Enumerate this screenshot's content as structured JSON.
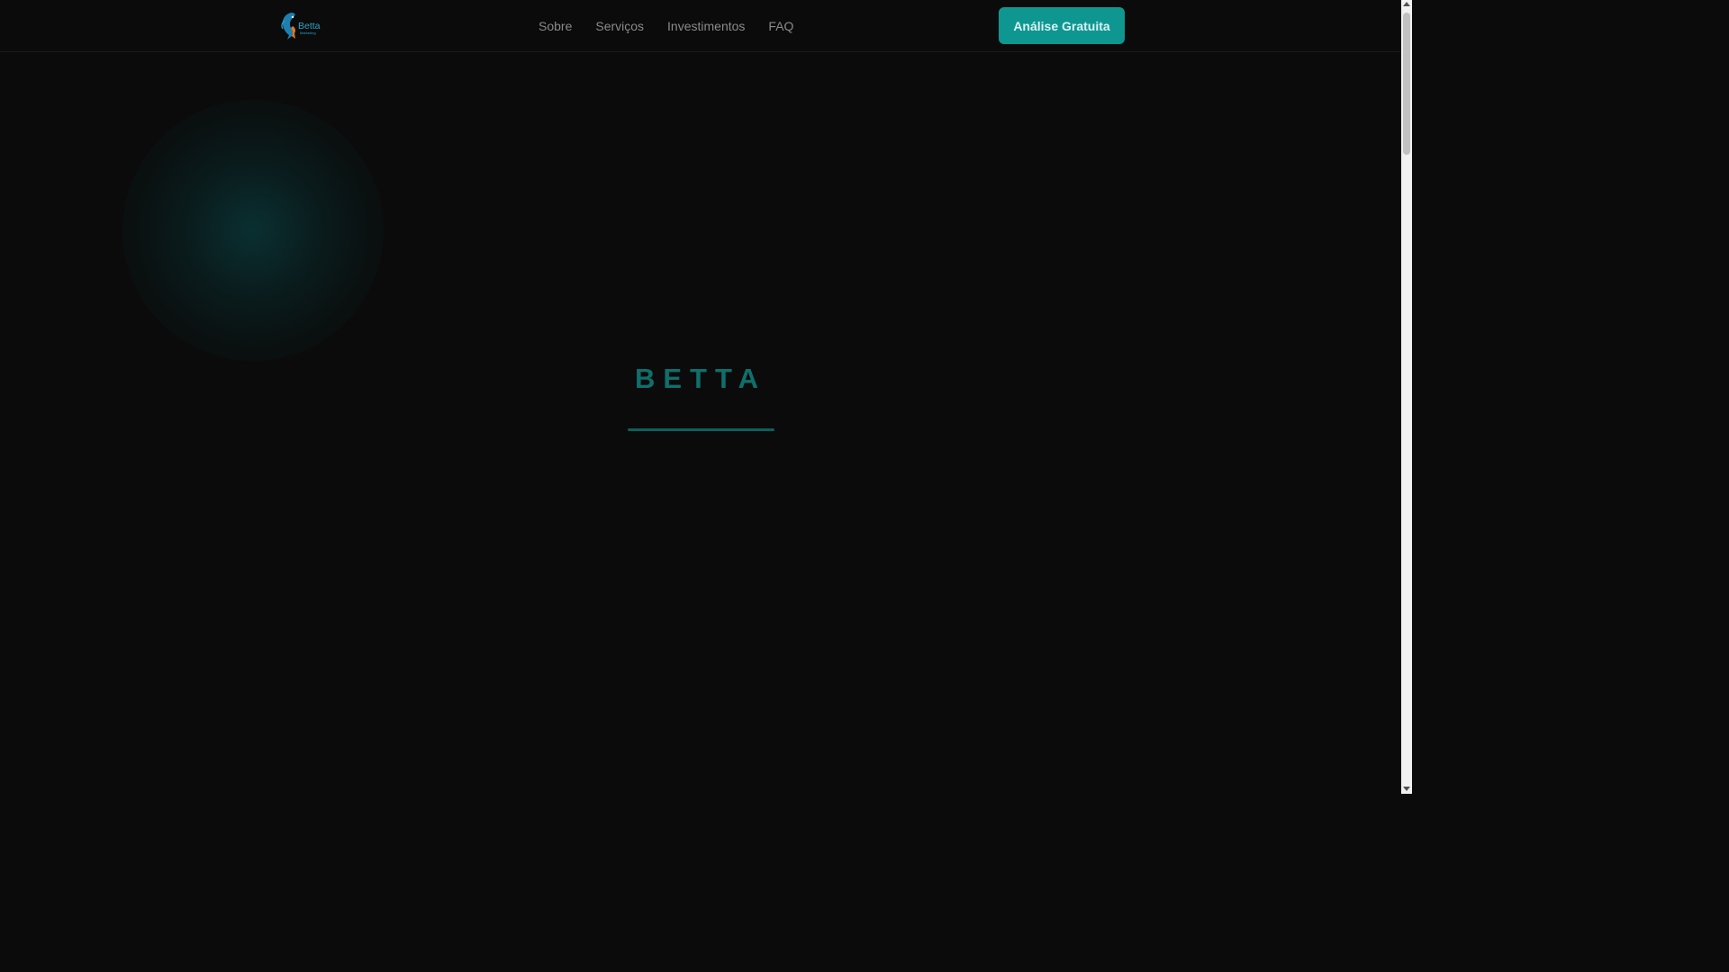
{
  "header": {
    "logo": {
      "text": "Betta",
      "subtext": "Marketing",
      "icon": "betta-fish-icon"
    },
    "nav": [
      {
        "label": "Sobre"
      },
      {
        "label": "Serviços"
      },
      {
        "label": "Investimentos"
      },
      {
        "label": "FAQ"
      }
    ],
    "cta_label": "Análise Gratuita"
  },
  "hero": {
    "brand_title": "BETTA"
  },
  "colors": {
    "background": "#0b0b0b",
    "accent": "#0e9791",
    "nav_text": "#8a8a8a",
    "brand_title": "#0f6f6b",
    "logo": "#2aa4c9"
  }
}
